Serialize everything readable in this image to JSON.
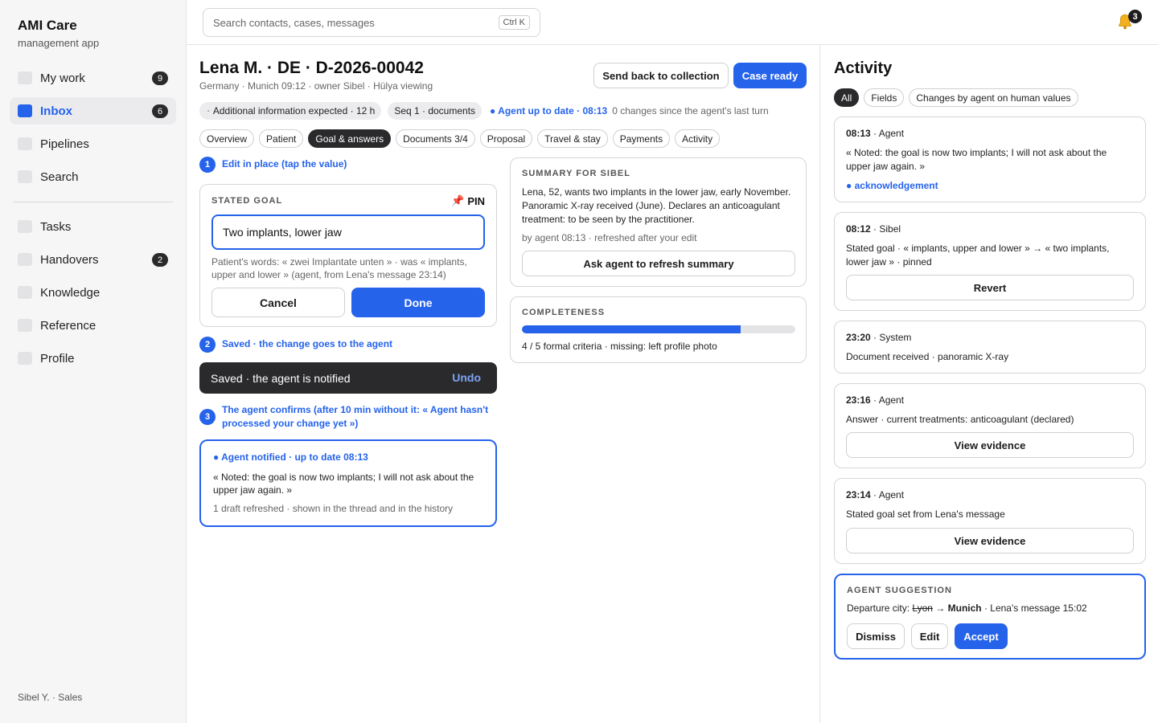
{
  "app": {
    "name": "AMI Care",
    "subtitle": "management app"
  },
  "sidebar": {
    "items": [
      {
        "label": "My work",
        "badge": "9"
      },
      {
        "label": "Inbox",
        "badge": "6",
        "active": true
      },
      {
        "label": "Pipelines"
      },
      {
        "label": "Search"
      },
      {
        "label": "Tasks"
      },
      {
        "label": "Handovers",
        "badge": "2"
      },
      {
        "label": "Knowledge"
      },
      {
        "label": "Reference"
      },
      {
        "label": "Profile"
      }
    ],
    "user": "Sibel Y. · Sales"
  },
  "topbar": {
    "search_placeholder": "Search contacts, cases, messages",
    "shortcut": "Ctrl K",
    "notifications": "3"
  },
  "case": {
    "title": "Lena M. · DE · D-2026-00042",
    "meta": "Germany · Munich 09:12 · owner Sibel · Hülya viewing",
    "send_back_label": "Send back to collection",
    "ready_label": "Case ready",
    "chip_expected": "Additional information expected · 12 h",
    "chip_seq": "Seq 1 · documents",
    "agent_status": "● Agent up to date · 08:13",
    "agent_changes": "0 changes since the agent's last turn"
  },
  "tabs": [
    {
      "label": "Overview"
    },
    {
      "label": "Patient"
    },
    {
      "label": "Goal & answers",
      "active": true
    },
    {
      "label": "Documents 3/4"
    },
    {
      "label": "Proposal"
    },
    {
      "label": "Travel & stay"
    },
    {
      "label": "Payments"
    },
    {
      "label": "Activity"
    }
  ],
  "steps": {
    "s1_num": "1",
    "s1": "Edit in place (tap the value)",
    "s2_num": "2",
    "s2": "Saved · the change goes to the agent",
    "s3_num": "3",
    "s3": "The agent confirms (after 10 min without it: « Agent hasn't processed your change yet »)"
  },
  "goal": {
    "label": "STATED GOAL",
    "pin_label": "PIN",
    "value": "Two implants, lower jaw",
    "note": "Patient's words: « zwei Implantate unten » · was « implants, upper and lower » (agent, from Lena's message 23:14)",
    "cancel_label": "Cancel",
    "done_label": "Done"
  },
  "toast": {
    "text": "Saved · the agent is notified",
    "undo_label": "Undo"
  },
  "confirm": {
    "head": "● Agent notified · up to date 08:13",
    "quote": "« Noted: the goal is now two implants; I will not ask about the upper jaw again. »",
    "foot": "1 draft refreshed · shown in the thread and in the history"
  },
  "summary": {
    "label": "SUMMARY FOR SIBEL",
    "text": "Lena, 52, wants two implants in the lower jaw, early November. Panoramic X-ray received (June). Declares an anticoagulant treatment: to be seen by the practitioner.",
    "meta": "by agent 08:13 · refreshed after your edit",
    "refresh_label": "Ask agent to refresh summary"
  },
  "completeness": {
    "label": "COMPLETENESS",
    "fraction": 0.8,
    "text": "4 / 5 formal criteria · missing: left profile photo"
  },
  "activity": {
    "title": "Activity",
    "filters": [
      {
        "label": "All",
        "active": true
      },
      {
        "label": "Fields"
      },
      {
        "label": "Changes by agent on human values"
      }
    ],
    "entries": [
      {
        "time": "08:13",
        "actor": " · Agent",
        "body": "« Noted: the goal is now two implants; I will not ask about the upper jaw again. »",
        "link": "● acknowledgement"
      },
      {
        "time": "08:12",
        "actor": " · Sibel",
        "body": "Stated goal · « implants, upper and lower » → « two implants, lower jaw » · pinned",
        "button": "Revert"
      },
      {
        "time": "23:20",
        "actor": " · System",
        "body": "Document received · panoramic X-ray"
      },
      {
        "time": "23:16",
        "actor": " · Agent",
        "body": "Answer · current treatments: anticoagulant (declared)",
        "button": "View evidence"
      },
      {
        "time": "23:14",
        "actor": " · Agent",
        "body": "Stated goal set from Lena's message",
        "button": "View evidence"
      }
    ],
    "suggestion": {
      "label": "AGENT SUGGESTION",
      "prefix": "Departure city: ",
      "old": "Lyon",
      "arrow": " → ",
      "new": "Munich",
      "suffix": " · Lena's message 15:02",
      "dismiss_label": "Dismiss",
      "edit_label": "Edit",
      "accept_label": "Accept"
    }
  },
  "colors": {
    "accent": "#2563eb",
    "dark": "#2a2a2c"
  },
  "icons": {
    "notifications": "bell-icon",
    "pin": "pushpin-icon"
  }
}
